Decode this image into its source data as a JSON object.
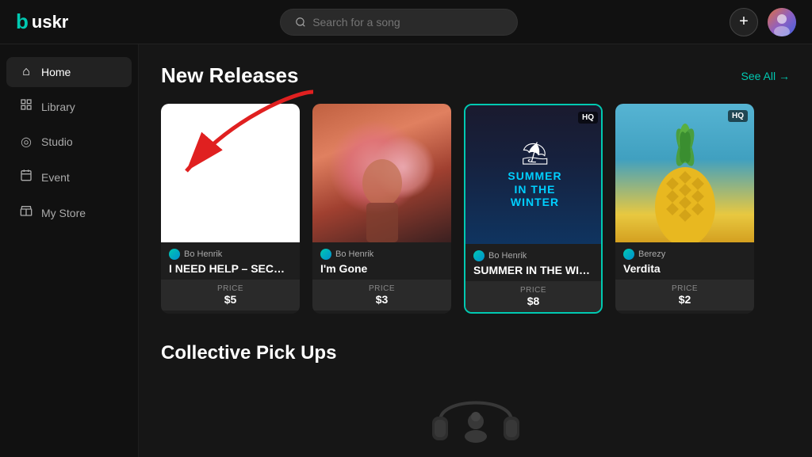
{
  "header": {
    "logo_text": "uskr",
    "search_placeholder": "Search for a song",
    "add_button_label": "+",
    "avatar_alt": "User Avatar"
  },
  "sidebar": {
    "items": [
      {
        "id": "home",
        "label": "Home",
        "icon": "🏠",
        "active": true
      },
      {
        "id": "library",
        "label": "Library",
        "icon": "📊",
        "active": false
      },
      {
        "id": "studio",
        "label": "Studio",
        "icon": "🎛️",
        "active": false
      },
      {
        "id": "event",
        "label": "Event",
        "icon": "📅",
        "active": false
      },
      {
        "id": "mystore",
        "label": "My Store",
        "icon": "🏪",
        "active": false
      }
    ]
  },
  "main": {
    "new_releases": {
      "title": "New Releases",
      "see_all": "See All →",
      "songs": [
        {
          "id": "song1",
          "cover_type": "white",
          "artist": "Bo Henrik",
          "title": "I NEED HELP – SECRET...",
          "price_label": "PRICE",
          "price": "$5",
          "hq": false
        },
        {
          "id": "song2",
          "cover_type": "floral",
          "artist": "Bo Henrik",
          "title": "I'm Gone",
          "price_label": "PRICE",
          "price": "$3",
          "hq": false
        },
        {
          "id": "song3",
          "cover_type": "summer",
          "artist": "Bo Henrik",
          "title": "SUMMER IN THE WINT...",
          "price_label": "PRICE",
          "price": "$8",
          "hq": true
        },
        {
          "id": "song4",
          "cover_type": "pineapple",
          "artist": "Berezy",
          "title": "Verdita",
          "price_label": "PRICE",
          "price": "$2",
          "hq": true
        }
      ]
    },
    "collective": {
      "title": "Collective Pick Ups"
    }
  },
  "colors": {
    "accent": "#00c9b1",
    "background": "#161616",
    "sidebar_bg": "#111",
    "card_bg": "#1e1e1e"
  }
}
